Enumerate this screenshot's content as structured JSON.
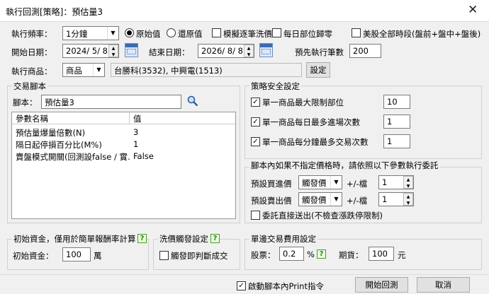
{
  "window": {
    "title": "執行回測[策略]：預估量3"
  },
  "row1": {
    "freq_label": "執行頻率：",
    "freq_value": "1分鐘",
    "radio_original": "原始值",
    "radio_restored": "還原值",
    "chk_tick": "模擬逐筆洗價",
    "chk_daily_zero": "每日部位歸零",
    "chk_us_all": "美股全部時段(盤前+盤中+盤後)"
  },
  "row2": {
    "start_label": "開始日期：",
    "start_value": "2024/ 5/ 8",
    "end_label": "結束日期：",
    "end_value": "2026/ 8/ 8",
    "pre_label": "預先執行筆數",
    "pre_value": "200"
  },
  "row3": {
    "product_label": "執行商品：",
    "product_type": "商品",
    "product_value": "台勝科(3532), 中興電(1513)",
    "set_button": "設定"
  },
  "script": {
    "group": "交易腳本",
    "label": "腳本：",
    "value": "預估量3",
    "col_name": "參數名稱",
    "col_value": "值",
    "params": [
      {
        "name": "預估量爆量倍數(N)",
        "value": "3"
      },
      {
        "name": "隔日起停損百分比(M%)",
        "value": "1"
      },
      {
        "name": "賣盤模式開關(回測設false / 實…",
        "value": "False"
      }
    ]
  },
  "safety": {
    "group": "策略安全設定",
    "items": [
      {
        "label": "單一商品最大限制部位",
        "value": "10"
      },
      {
        "label": "單一商品每日最多進場次數",
        "value": "1"
      },
      {
        "label": "單一商品每分鐘最多交易次數",
        "value": "1"
      }
    ]
  },
  "order": {
    "group": "腳本內如果不指定價格時，請依照以下參數執行委託",
    "buy_label": "預設買進價",
    "buy_price": "觸發價",
    "buy_tick_label": "+/-檔",
    "buy_tick": "1",
    "sell_label": "預設賣出價",
    "sell_price": "觸發價",
    "sell_tick_label": "+/-檔",
    "sell_tick": "1",
    "direct_label": "委託直接送出(不檢查漲跌停限制)"
  },
  "capital": {
    "group": "初始資金，僅用於簡單報酬率計算",
    "label": "初始資金：",
    "value": "100",
    "unit": "萬"
  },
  "wash": {
    "group": "洗價觸發設定",
    "label": "觸發即判斷成交"
  },
  "fee": {
    "group": "單邊交易費用設定",
    "stock_label": "股票：",
    "stock_value": "0.2",
    "stock_unit": "%",
    "futures_label": "期貨：",
    "futures_value": "100",
    "futures_unit": "元"
  },
  "footer": {
    "print_label": "啟動腳本內Print指令",
    "start_button": "開始回測",
    "cancel_button": "取消"
  },
  "help_mark": "?",
  "colors": {
    "help_green": "#2f7d16",
    "header_bg": "#ffffff",
    "panel_bg": "#f0f0f0"
  }
}
